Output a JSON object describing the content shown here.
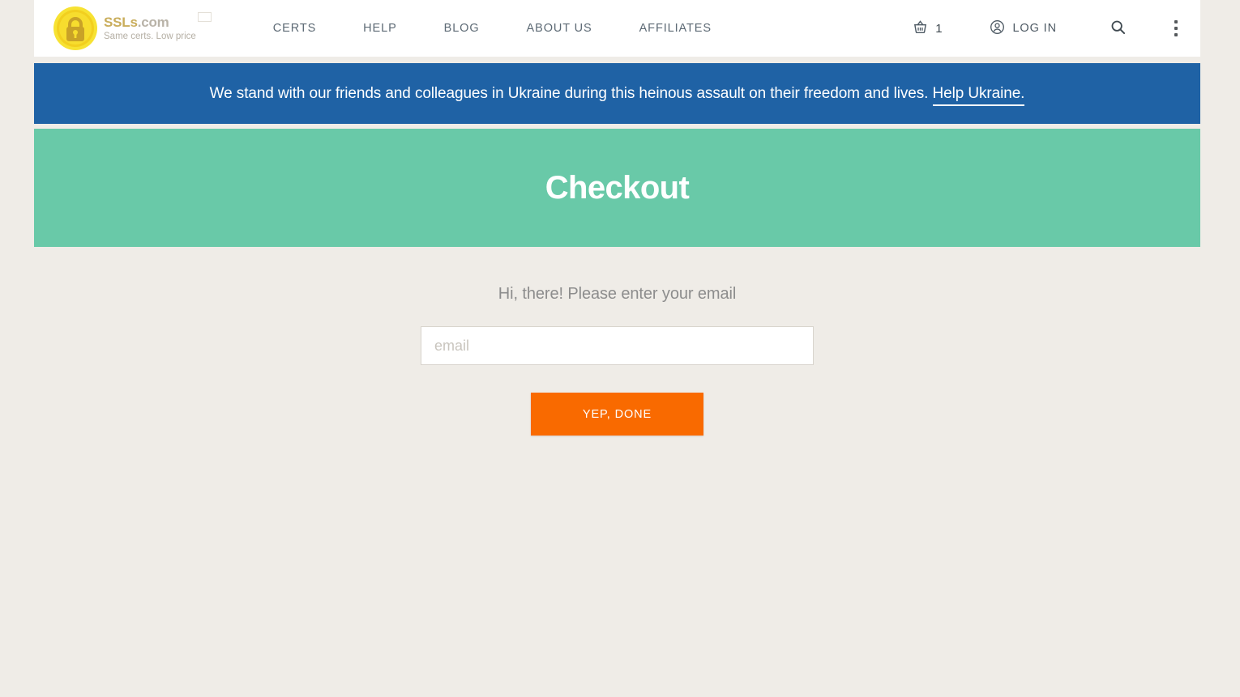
{
  "header": {
    "logo": {
      "title_main": "SSLs",
      "title_suffix": ".com",
      "tagline": "Same certs. Low price",
      "flag_icon": "ukraine-flag-icon",
      "lock_icon": "lock-coin-icon"
    },
    "nav": [
      {
        "label": "CERTS"
      },
      {
        "label": "HELP"
      },
      {
        "label": "BLOG"
      },
      {
        "label": "ABOUT US"
      },
      {
        "label": "AFFILIATES"
      }
    ],
    "cart": {
      "icon": "basket-icon",
      "count": "1"
    },
    "login": {
      "icon": "user-circle-icon",
      "label": "LOG IN"
    },
    "search": {
      "icon": "search-icon"
    },
    "menu": {
      "icon": "kebab-menu-icon"
    }
  },
  "banner": {
    "text": "We stand with our friends and colleagues in Ukraine during this heinous assault on their freedom and lives.",
    "link_label": "Help Ukraine.",
    "background": "#1f62a5"
  },
  "hero": {
    "title": "Checkout",
    "background": "#69c9a8"
  },
  "main": {
    "prompt": "Hi, there! Please enter your email",
    "email": {
      "placeholder": "email",
      "value": ""
    },
    "submit_label": "YEP, DONE",
    "accent": "#f96a00",
    "background": "#efece7"
  }
}
